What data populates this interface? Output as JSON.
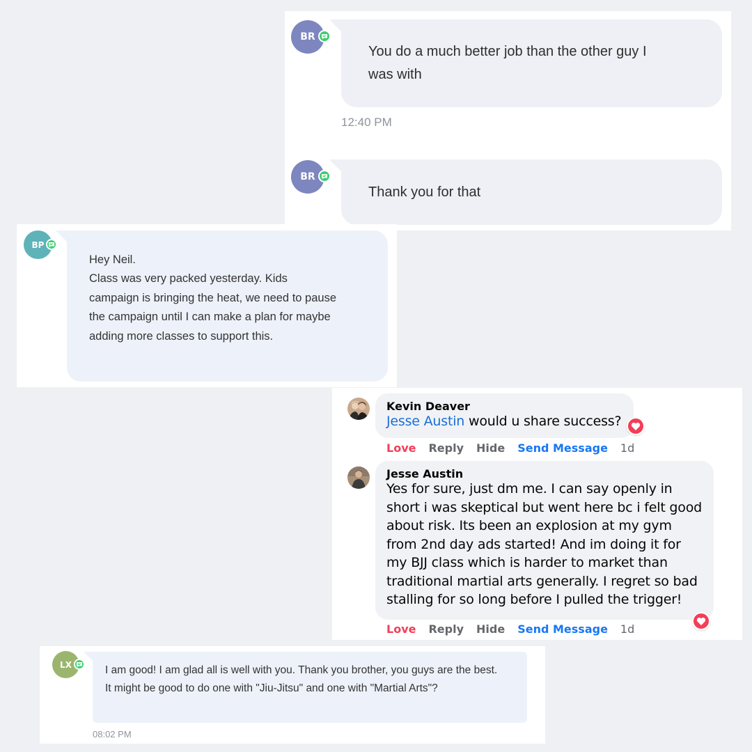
{
  "card_br": {
    "message_1": {
      "avatar_initials": "BR",
      "text": "You do a much better job than the other guy I was with",
      "time": "12:40 PM"
    },
    "message_2": {
      "avatar_initials": "BR",
      "text": "Thank you for that"
    }
  },
  "card_bp": {
    "avatar_initials": "BP",
    "greeting": "Hey Neil.",
    "body": "Class was very packed yesterday. Kids campaign is bringing the heat, we need to pause the campaign until I can make a plan for maybe adding more classes to support this."
  },
  "card_fb": {
    "comment_1": {
      "author": "Kevin Deaver",
      "mention": "Jesse Austin",
      "text": " would u share success?",
      "actions": {
        "love": "Love",
        "reply": "Reply",
        "hide": "Hide",
        "send": "Send Message",
        "time": "1d"
      }
    },
    "comment_2": {
      "author": "Jesse Austin",
      "text": "Yes for sure, just dm me. I can say openly in short i was skeptical but went here bc i felt good about risk. Its been an explosion at my gym from 2nd day ads started! And im doing it for my BJJ class which is harder to market than traditional martial arts generally. I regret so bad stalling for so long before I pulled the trigger!",
      "actions": {
        "love": "Love",
        "reply": "Reply",
        "hide": "Hide",
        "send": "Send Message",
        "time": "1d"
      }
    }
  },
  "card_lx": {
    "avatar_initials": "LX",
    "text": "I am good! I am glad all is well with you. Thank you brother, you guys are the best. It might be good to do one with \"Jiu-Jitsu\" and one with \"Martial Arts\"?",
    "time": "08:02 PM"
  },
  "colors": {
    "background": "#eff0f4",
    "avatar_br": "#7d86be",
    "avatar_bp": "#5eb3b9",
    "avatar_lx": "#9cb56e",
    "chat_badge": "#3fce72",
    "love": "#f33e58",
    "link": "#1877f2"
  },
  "icons": [
    "chat-badge-icon",
    "heart-reaction-icon"
  ]
}
